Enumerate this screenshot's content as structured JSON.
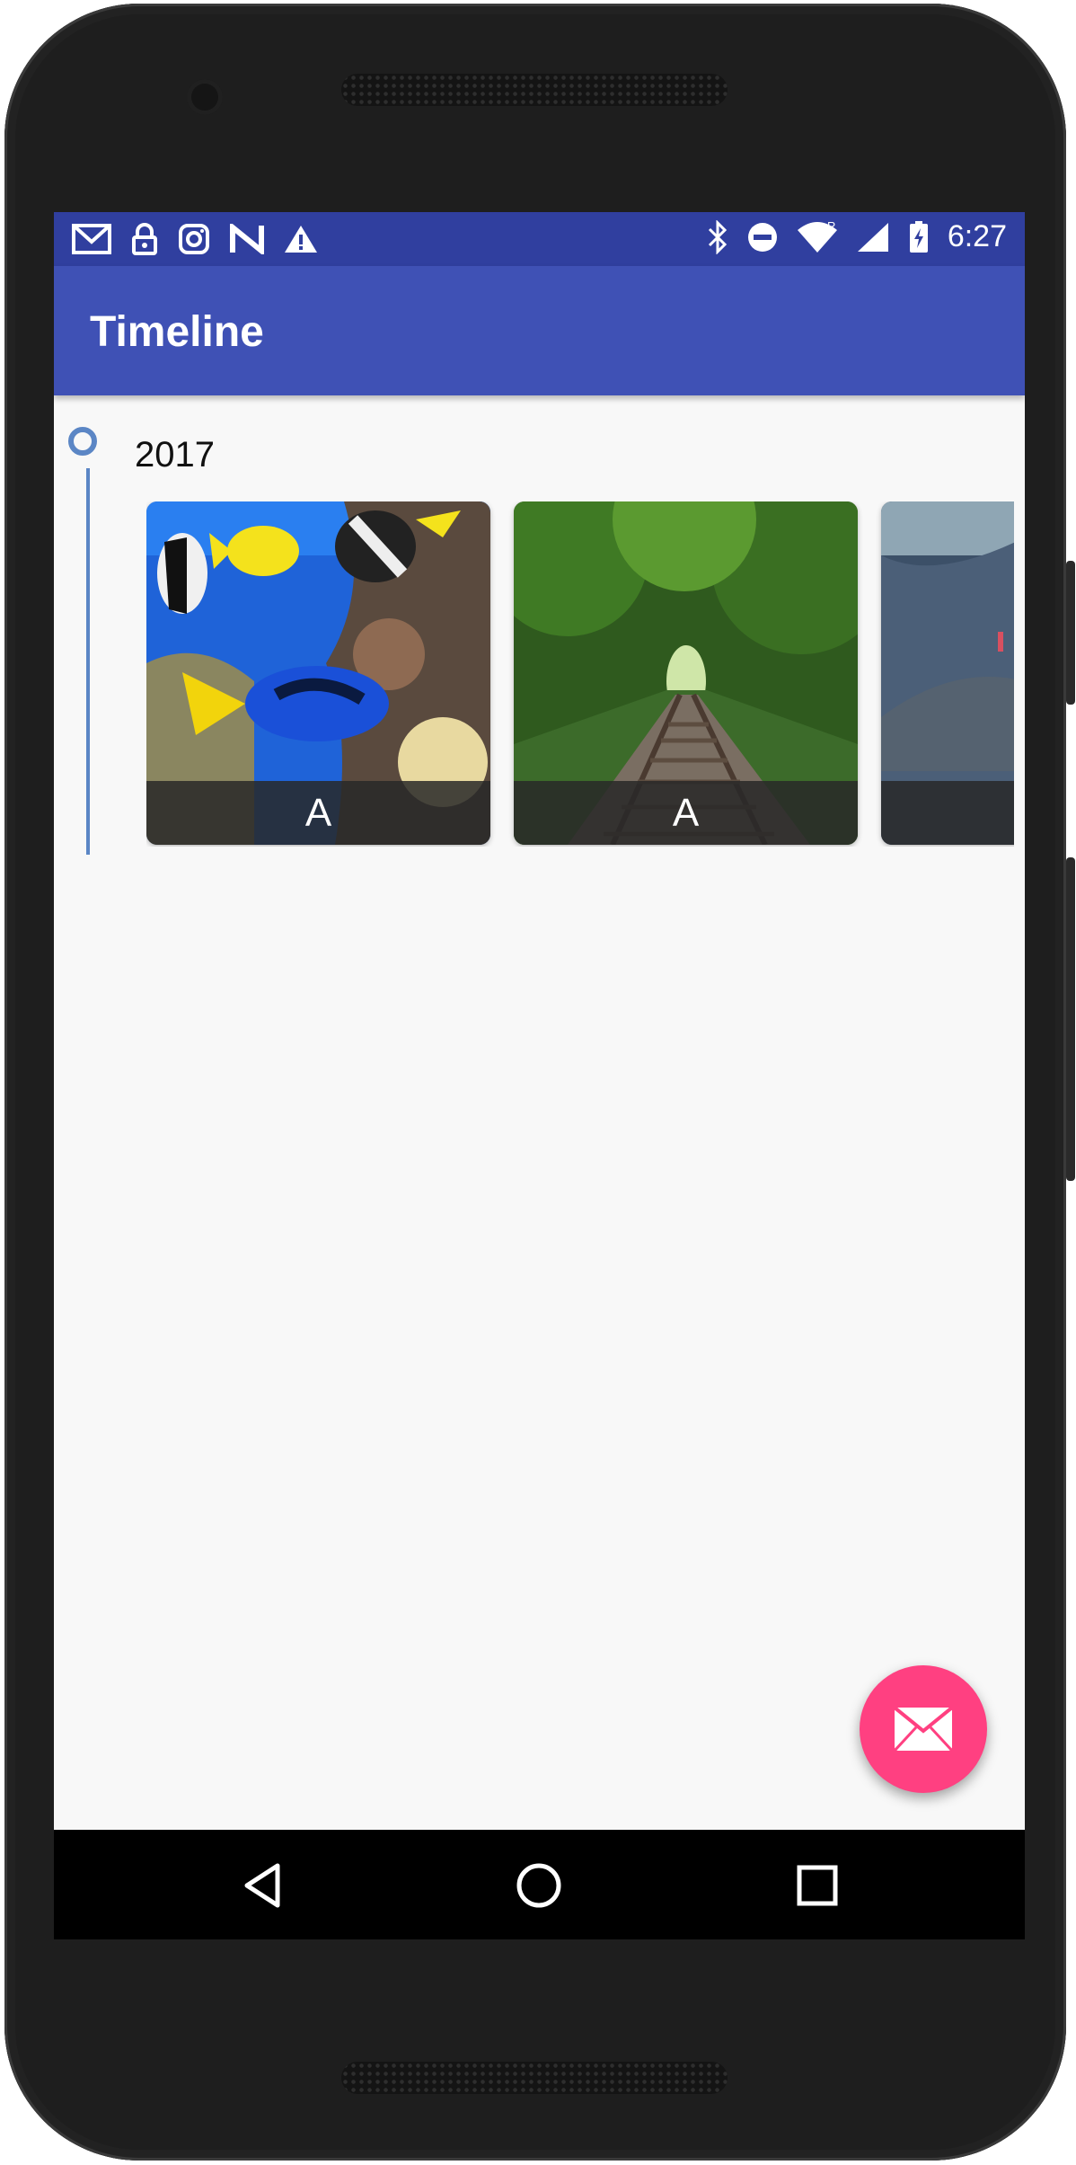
{
  "status_bar": {
    "time": "6:27",
    "left_icons": [
      "gmail-icon",
      "lock-icon",
      "instagram-icon",
      "n-app-icon",
      "warning-icon"
    ],
    "right_icons": [
      "bluetooth-icon",
      "do-not-disturb-icon",
      "wifi-icon",
      "signal-icon",
      "battery-icon"
    ],
    "signal_badge": "R"
  },
  "app_bar": {
    "title": "Timeline"
  },
  "timeline": {
    "year": "2017",
    "cards": [
      {
        "caption": "A",
        "image": "coral-reef-fish"
      },
      {
        "caption": "A",
        "image": "forest-railway-track"
      },
      {
        "caption": "",
        "image": "rocky-lake-shore"
      }
    ]
  },
  "fab": {
    "icon": "mail-icon"
  },
  "nav_bar": {
    "buttons": [
      "back-icon",
      "home-icon",
      "recents-icon"
    ]
  },
  "colors": {
    "status_bar": "#303f9f",
    "app_bar": "#3f51b5",
    "timeline_accent": "#5b86c5",
    "fab": "#ff4081",
    "background": "#f8f8f8"
  }
}
